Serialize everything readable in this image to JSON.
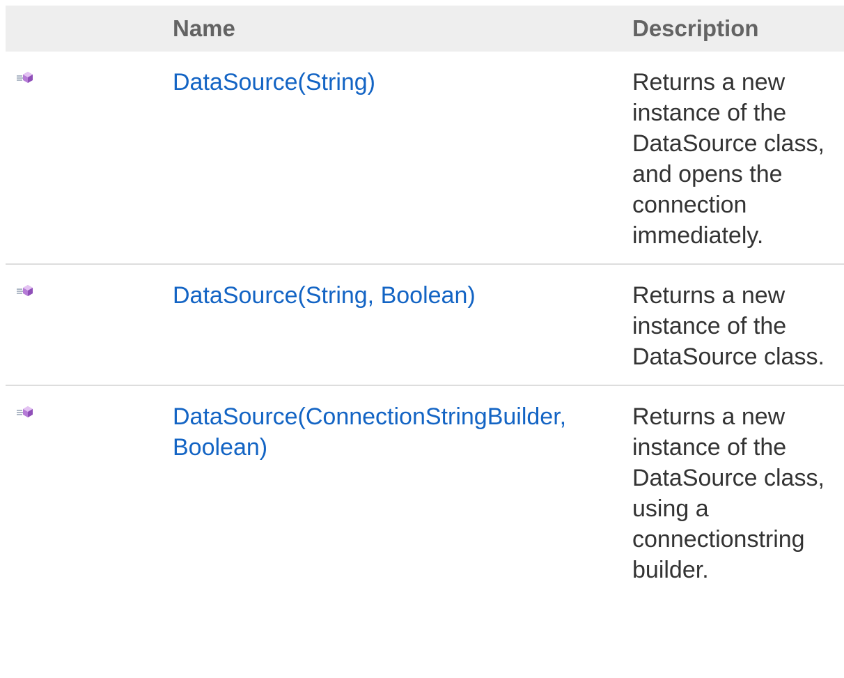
{
  "table": {
    "headers": {
      "icon": "",
      "name": "Name",
      "description": "Description"
    },
    "rows": [
      {
        "icon": "public-method-icon",
        "name": "DataSource(String)",
        "description": "Returns a new instance of the DataSource class, and opens the connection immediately."
      },
      {
        "icon": "public-method-icon",
        "name": "DataSource(String, Boolean)",
        "description": "Returns a new instance of the DataSource class."
      },
      {
        "icon": "public-method-icon",
        "name": "DataSource(ConnectionStringBuilder, Boolean)",
        "description": "Returns a new instance of the DataSource class, using a connectionstring builder."
      }
    ]
  },
  "colors": {
    "header_bg": "#eeeeee",
    "header_text": "#636363",
    "link": "#1364c4",
    "body_text": "#333333",
    "row_divider": "#dddddd",
    "icon_gem": "#b57bd6"
  }
}
